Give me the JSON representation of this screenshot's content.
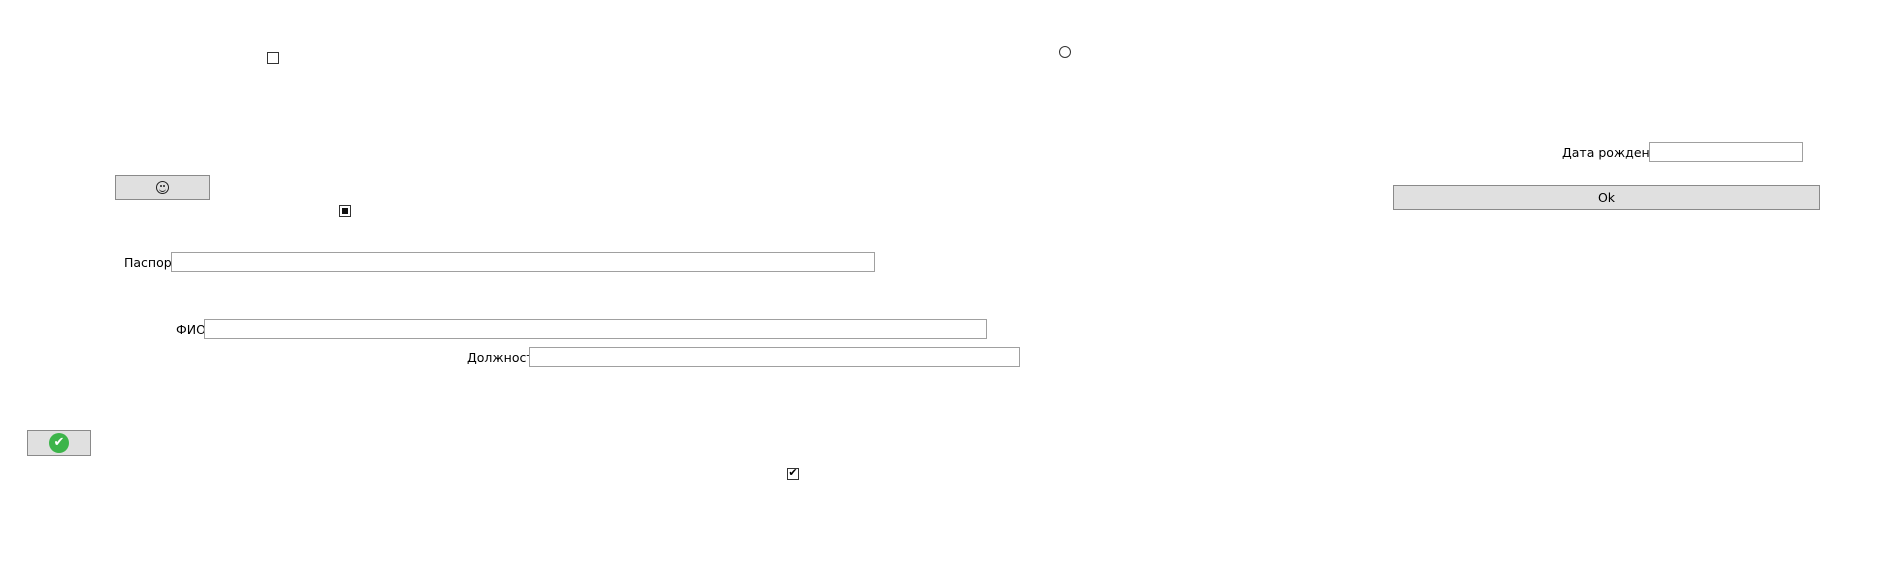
{
  "fields": {
    "birthdate": {
      "label": "Дата рождения",
      "value": "",
      "placeholder": ""
    },
    "passport": {
      "label": "Паспорт",
      "value": "",
      "placeholder": ""
    },
    "fio": {
      "label": "ФИО",
      "value": "",
      "placeholder": ""
    },
    "position": {
      "label": "Должность",
      "value": "",
      "placeholder": ""
    }
  },
  "buttons": {
    "ok_label": "Ok",
    "smiley_icon": "smiley-icon",
    "confirm_icon": "green-check-icon"
  },
  "controls": {
    "checkbox_top": {
      "state": "unchecked"
    },
    "radio_top": {
      "state": "unselected"
    },
    "checkbox_middle": {
      "state": "indeterminate"
    },
    "checkbox_bottom": {
      "state": "checked"
    }
  },
  "colors": {
    "button_bg": "#e0e0e0",
    "confirm_green": "#3cb44a"
  }
}
